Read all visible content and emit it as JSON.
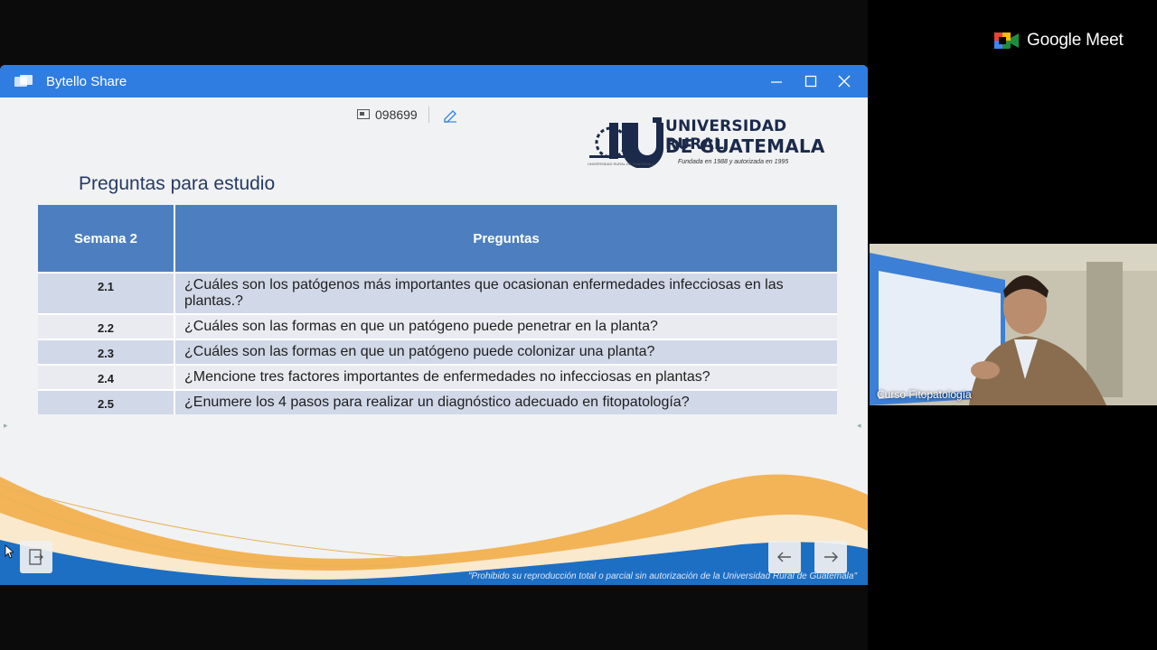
{
  "meet": {
    "brand": "Google Meet",
    "participant_label": "Curso Fitopatología"
  },
  "window": {
    "title": "Bytello Share"
  },
  "toolbar": {
    "room_code": "098699"
  },
  "university": {
    "name_line1": "UNIVERSIDAD RURAL",
    "name_line2": "DE GUATEMALA",
    "founded": "Fundada en 1988 y autorizada en 1995",
    "small_text": "UNIVERSIDAD RURAL DE GUATEMALA"
  },
  "slide": {
    "heading": "Preguntas para estudio",
    "table": {
      "col1_header": "Semana 2",
      "col2_header": "Preguntas",
      "rows": [
        {
          "num": "2.1",
          "text": "¿Cuáles son los patógenos más importantes que ocasionan enfermedades infecciosas en las plantas.?"
        },
        {
          "num": "2.2",
          "text": "¿Cuáles son las formas en que un patógeno puede penetrar en la planta?"
        },
        {
          "num": "2.3",
          "text": "¿Cuáles son las formas en que un patógeno puede colonizar una planta?"
        },
        {
          "num": "2.4",
          "text": "¿Mencione tres factores importantes de enfermedades no infecciosas en plantas?"
        },
        {
          "num": "2.5",
          "text": "¿Enumere los 4 pasos para realizar un diagnóstico adecuado en fitopatología?"
        }
      ]
    },
    "footer": "\"Prohibido su reproducción total o parcial sin autorización de la Universidad Rural de Guatemala\""
  },
  "colors": {
    "titlebar": "#2f7de1",
    "table_header": "#4d7fc0",
    "row_odd": "#d1d8e8",
    "row_even": "#e9ebf0"
  }
}
